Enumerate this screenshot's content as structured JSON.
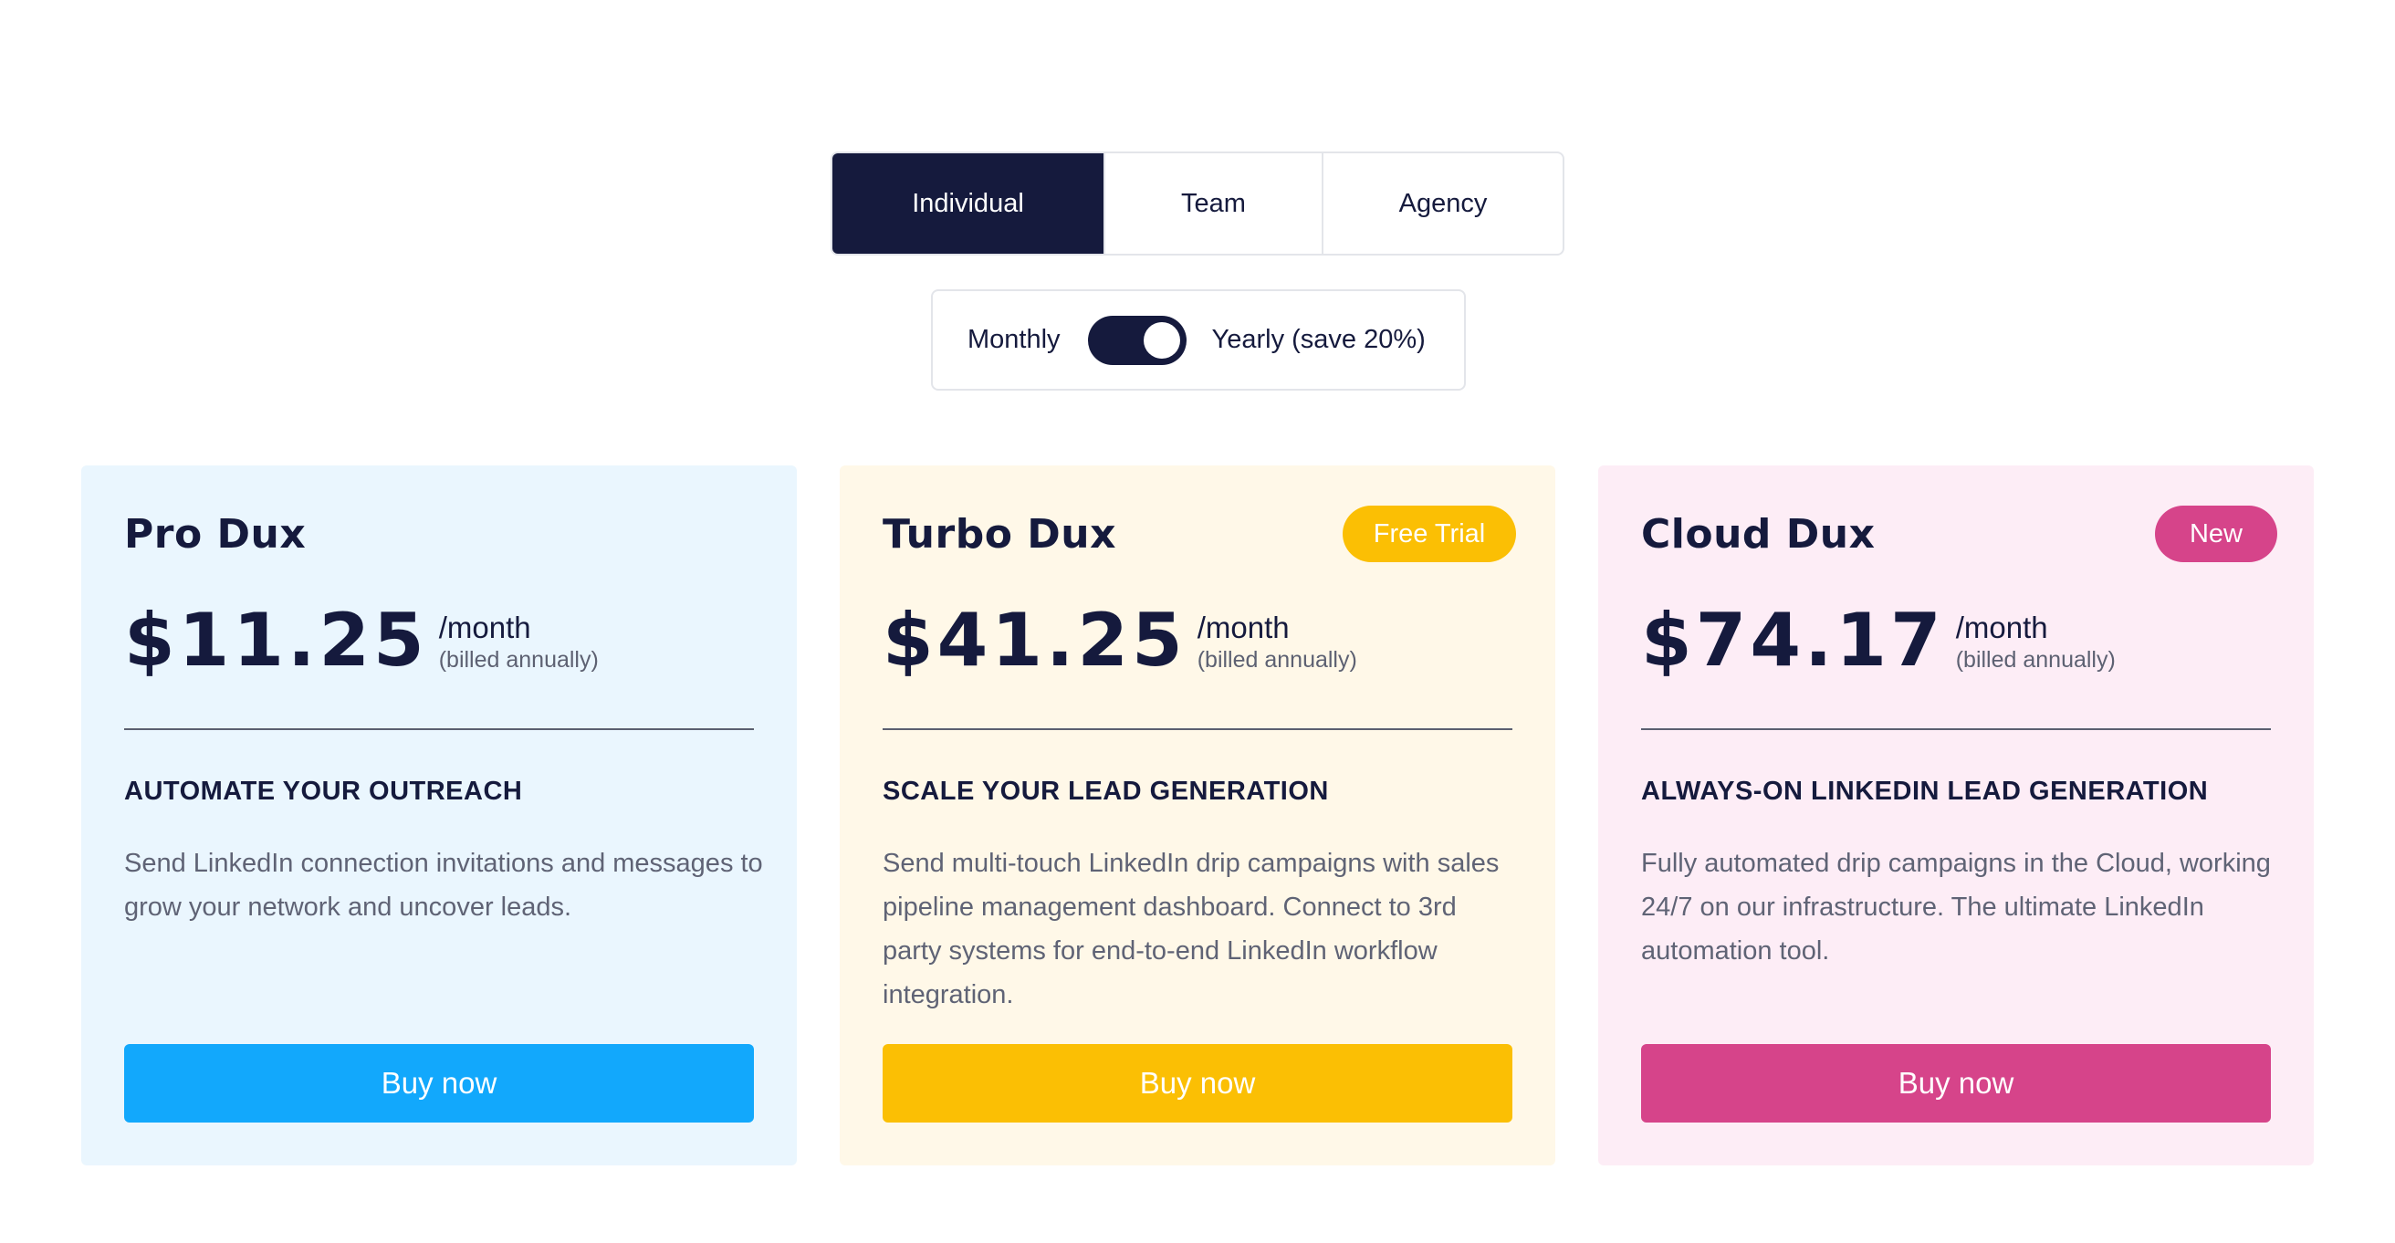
{
  "tabs": [
    {
      "label": "Individual",
      "active": true
    },
    {
      "label": "Team",
      "active": false
    },
    {
      "label": "Agency",
      "active": false
    }
  ],
  "billing": {
    "monthly_label": "Monthly",
    "yearly_label": "Yearly (save 20%)",
    "toggle_state": "yearly"
  },
  "plans": [
    {
      "name": "Pro Dux",
      "badge": "",
      "price": "$11.25",
      "per": "/month",
      "billed": "(billed annually)",
      "heading": "AUTOMATE YOUR OUTREACH",
      "description": "Send LinkedIn connection invitations and messages to grow your network and uncover leads.",
      "button": "Buy now",
      "colors": {
        "background": "#eaf6fe",
        "accent": "#12a8fc"
      }
    },
    {
      "name": "Turbo Dux",
      "badge": "Free Trial",
      "price": "$41.25",
      "per": "/month",
      "billed": "(billed annually)",
      "heading": "SCALE YOUR LEAD GENERATION",
      "description": "Send multi-touch LinkedIn drip campaigns with sales pipeline management dashboard. Connect to 3rd party systems for end-to-end LinkedIn workflow integration.",
      "button": "Buy now",
      "colors": {
        "background": "#fff8e8",
        "accent": "#fbbf04"
      }
    },
    {
      "name": "Cloud Dux",
      "badge": "New",
      "price": "$74.17",
      "per": "/month",
      "billed": "(billed annually)",
      "heading": "ALWAYS-ON LINKEDIN LEAD GENERATION",
      "description": "Fully automated drip campaigns in the Cloud, working 24/7 on our infrastructure. The ultimate LinkedIn automation tool.",
      "button": "Buy now",
      "colors": {
        "background": "#fdedf6",
        "accent": "#d6448a"
      }
    }
  ],
  "colors": {
    "navy": "#151a3d",
    "border": "#e3e5ea"
  }
}
